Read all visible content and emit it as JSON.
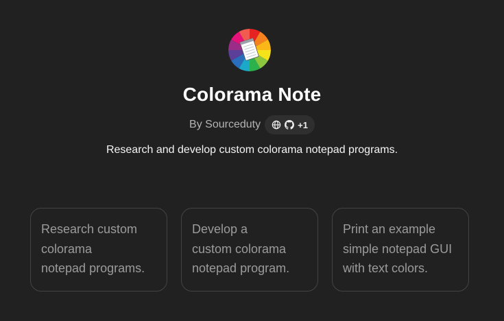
{
  "gpt": {
    "name": "Colorama Note",
    "byline": "By Sourceduty",
    "badge": {
      "icons": [
        "globe-icon",
        "github-icon"
      ],
      "extra_count": "+1"
    },
    "description": "Research and develop custom colorama notepad programs.",
    "logo_colors": [
      "#e52421",
      "#f5821f",
      "#fbb718",
      "#f4e31a",
      "#8cc63f",
      "#2bb24c",
      "#1ca9c9",
      "#2a6ebb",
      "#5b3f99",
      "#9b2d89",
      "#e6127a",
      "#f15a4f"
    ]
  },
  "conversation_starters": [
    {
      "text": "Research custom\ncolorama\nnotepad programs."
    },
    {
      "text": "Develop a\ncustom colorama\nnotepad program."
    },
    {
      "text": "Print an example\nsimple notepad GUI\nwith text colors."
    }
  ]
}
